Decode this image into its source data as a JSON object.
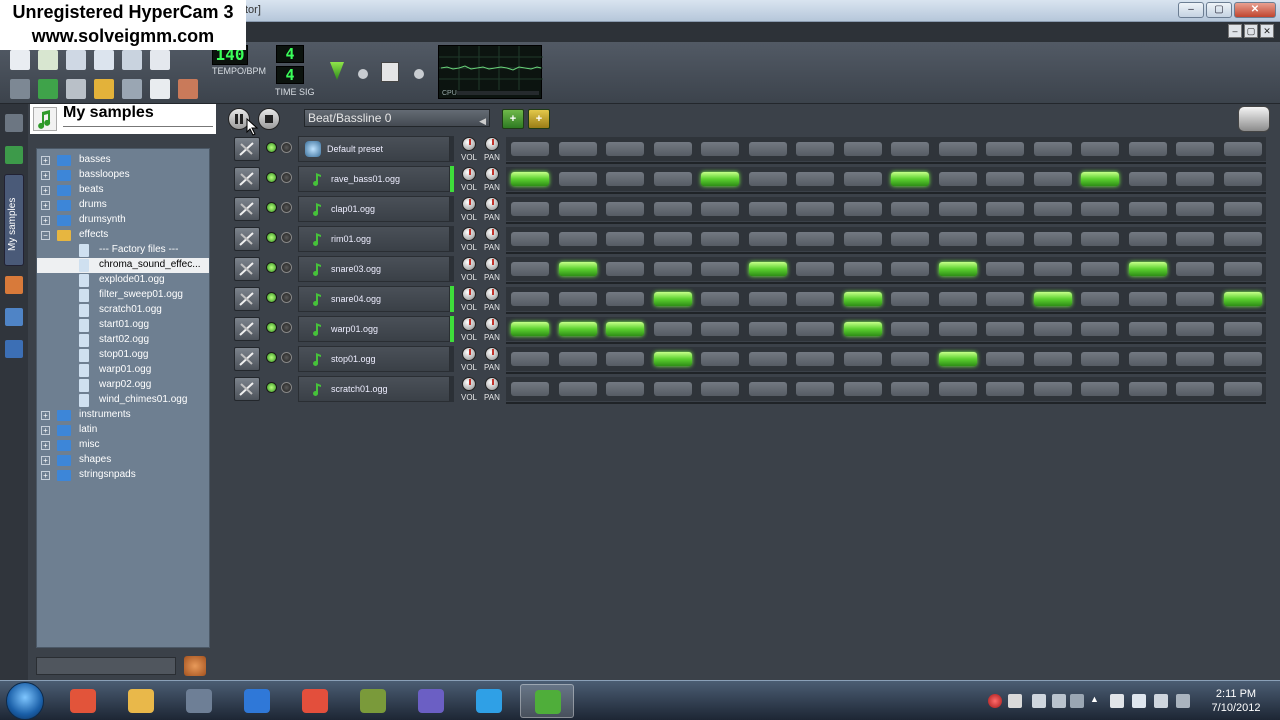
{
  "watermark": {
    "line1": "Unregistered HyperCam 3",
    "line2": "www.solveigmm.com"
  },
  "window": {
    "title_fragment": "tor]",
    "min": "‒",
    "max": "▢",
    "close": "✕",
    "inner_min": "‒",
    "inner_max": "▢",
    "inner_close": "✕"
  },
  "toolbar": {
    "tempo_value": "140",
    "tempo_label": "TEMPO/BPM",
    "timesig_num": "4",
    "timesig_den": "4",
    "timesig_label": "TIME SIG",
    "cpu_label": "CPU"
  },
  "sidebar": {
    "tab_label": "My samples"
  },
  "browser": {
    "title": "My samples",
    "filter_placeholder": "",
    "tree": [
      {
        "label": "basses",
        "level": 0,
        "type": "folder",
        "expander": "+"
      },
      {
        "label": "bassloopes",
        "level": 0,
        "type": "folder",
        "expander": "+"
      },
      {
        "label": "beats",
        "level": 0,
        "type": "folder",
        "expander": "+"
      },
      {
        "label": "drums",
        "level": 0,
        "type": "folder",
        "expander": "+"
      },
      {
        "label": "drumsynth",
        "level": 0,
        "type": "folder",
        "expander": "+"
      },
      {
        "label": "effects",
        "level": 0,
        "type": "folder-open",
        "expander": "−"
      },
      {
        "label": "--- Factory files ---",
        "level": 1,
        "type": "file"
      },
      {
        "label": "chroma_sound_effec...",
        "level": 1,
        "type": "file",
        "selected": true
      },
      {
        "label": "explode01.ogg",
        "level": 1,
        "type": "file"
      },
      {
        "label": "filter_sweep01.ogg",
        "level": 1,
        "type": "file"
      },
      {
        "label": "scratch01.ogg",
        "level": 1,
        "type": "file"
      },
      {
        "label": "start01.ogg",
        "level": 1,
        "type": "file"
      },
      {
        "label": "start02.ogg",
        "level": 1,
        "type": "file"
      },
      {
        "label": "stop01.ogg",
        "level": 1,
        "type": "file"
      },
      {
        "label": "warp01.ogg",
        "level": 1,
        "type": "file"
      },
      {
        "label": "warp02.ogg",
        "level": 1,
        "type": "file"
      },
      {
        "label": "wind_chimes01.ogg",
        "level": 1,
        "type": "file"
      },
      {
        "label": "instruments",
        "level": 0,
        "type": "folder",
        "expander": "+"
      },
      {
        "label": "latin",
        "level": 0,
        "type": "folder",
        "expander": "+"
      },
      {
        "label": "misc",
        "level": 0,
        "type": "folder",
        "expander": "+"
      },
      {
        "label": "shapes",
        "level": 0,
        "type": "folder",
        "expander": "+"
      },
      {
        "label": "stringsnpads",
        "level": 0,
        "type": "folder",
        "expander": "+"
      }
    ]
  },
  "bb_editor": {
    "selected_bassline": "Beat/Bassline 0",
    "vol_label": "VOL",
    "pan_label": "PAN",
    "tracks": [
      {
        "name": "Default preset",
        "icon": "preset-icon",
        "led": false,
        "steps": [
          0,
          0,
          0,
          0,
          0,
          0,
          0,
          0,
          0,
          0,
          0,
          0,
          0,
          0,
          0,
          0
        ]
      },
      {
        "name": "rave_bass01.ogg",
        "icon": "note-icon",
        "led": true,
        "steps": [
          1,
          0,
          0,
          0,
          1,
          0,
          0,
          0,
          1,
          0,
          0,
          0,
          1,
          0,
          0,
          0
        ]
      },
      {
        "name": "clap01.ogg",
        "icon": "note-icon",
        "led": false,
        "steps": [
          0,
          0,
          0,
          0,
          0,
          0,
          0,
          0,
          0,
          0,
          0,
          0,
          0,
          0,
          0,
          0
        ]
      },
      {
        "name": "rim01.ogg",
        "icon": "note-icon",
        "led": false,
        "steps": [
          0,
          0,
          0,
          0,
          0,
          0,
          0,
          0,
          0,
          0,
          0,
          0,
          0,
          0,
          0,
          0
        ]
      },
      {
        "name": "snare03.ogg",
        "icon": "note-icon",
        "led": false,
        "steps": [
          0,
          1,
          0,
          0,
          0,
          1,
          0,
          0,
          0,
          1,
          0,
          0,
          0,
          1,
          0,
          0
        ]
      },
      {
        "name": "snare04.ogg",
        "icon": "note-icon",
        "led": true,
        "steps": [
          0,
          0,
          0,
          1,
          0,
          0,
          0,
          1,
          0,
          0,
          0,
          1,
          0,
          0,
          0,
          1
        ]
      },
      {
        "name": "warp01.ogg",
        "icon": "note-icon",
        "led": true,
        "steps": [
          1,
          1,
          1,
          0,
          0,
          0,
          0,
          1,
          0,
          0,
          0,
          0,
          0,
          0,
          0,
          0
        ]
      },
      {
        "name": "stop01.ogg",
        "icon": "note-icon",
        "led": false,
        "steps": [
          0,
          0,
          0,
          1,
          0,
          0,
          0,
          0,
          0,
          1,
          0,
          0,
          0,
          0,
          0,
          0
        ]
      },
      {
        "name": "scratch01.ogg",
        "icon": "note-icon",
        "led": false,
        "steps": [
          0,
          0,
          0,
          0,
          0,
          0,
          0,
          0,
          0,
          0,
          0,
          0,
          0,
          0,
          0,
          0
        ]
      }
    ]
  },
  "taskbar": {
    "apps": [
      "paint-app-icon",
      "explorer-icon",
      "media-player-icon",
      "internet-explorer-icon",
      "chrome-icon",
      "minecraft-icon",
      "bittorrent-icon",
      "skype-icon",
      "lmms-icon"
    ],
    "time": "2:11 PM",
    "date": "7/10/2012"
  },
  "colors": {
    "step_on": "#5bd12f",
    "step_off": "#5f656d",
    "led_on": "#3ede3a",
    "background": "#3b4149"
  }
}
